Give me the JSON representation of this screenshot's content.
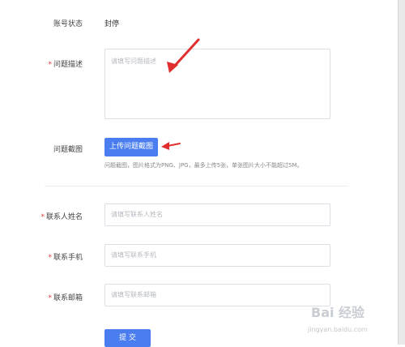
{
  "account_status": {
    "label": "账号状态",
    "value": "封停"
  },
  "problem_description": {
    "label": "问题描述",
    "required_mark": "*",
    "placeholder": "请填写问题描述"
  },
  "screenshot": {
    "label": "问题截图",
    "upload_button": "上传问题截图",
    "hint": "问题截图，图片格式为PNG、JPG，最多上传5张，单张图片大小不能超过5M。"
  },
  "contact_name": {
    "label": "联系人姓名",
    "required_mark": "*",
    "placeholder": "请填写联系人姓名"
  },
  "contact_phone": {
    "label": "联系手机",
    "required_mark": "*",
    "placeholder": "请填写联系手机"
  },
  "contact_email": {
    "label": "联系邮箱",
    "required_mark": "*",
    "placeholder": "请填写联系邮箱"
  },
  "submit": {
    "label": "提 交"
  },
  "watermark": {
    "text": "Bai 经验",
    "url": "jingyan.baidu.com"
  },
  "colors": {
    "accent": "#4a7ef0",
    "required": "#e4393c",
    "annotation_arrow": "#e02d2d"
  }
}
